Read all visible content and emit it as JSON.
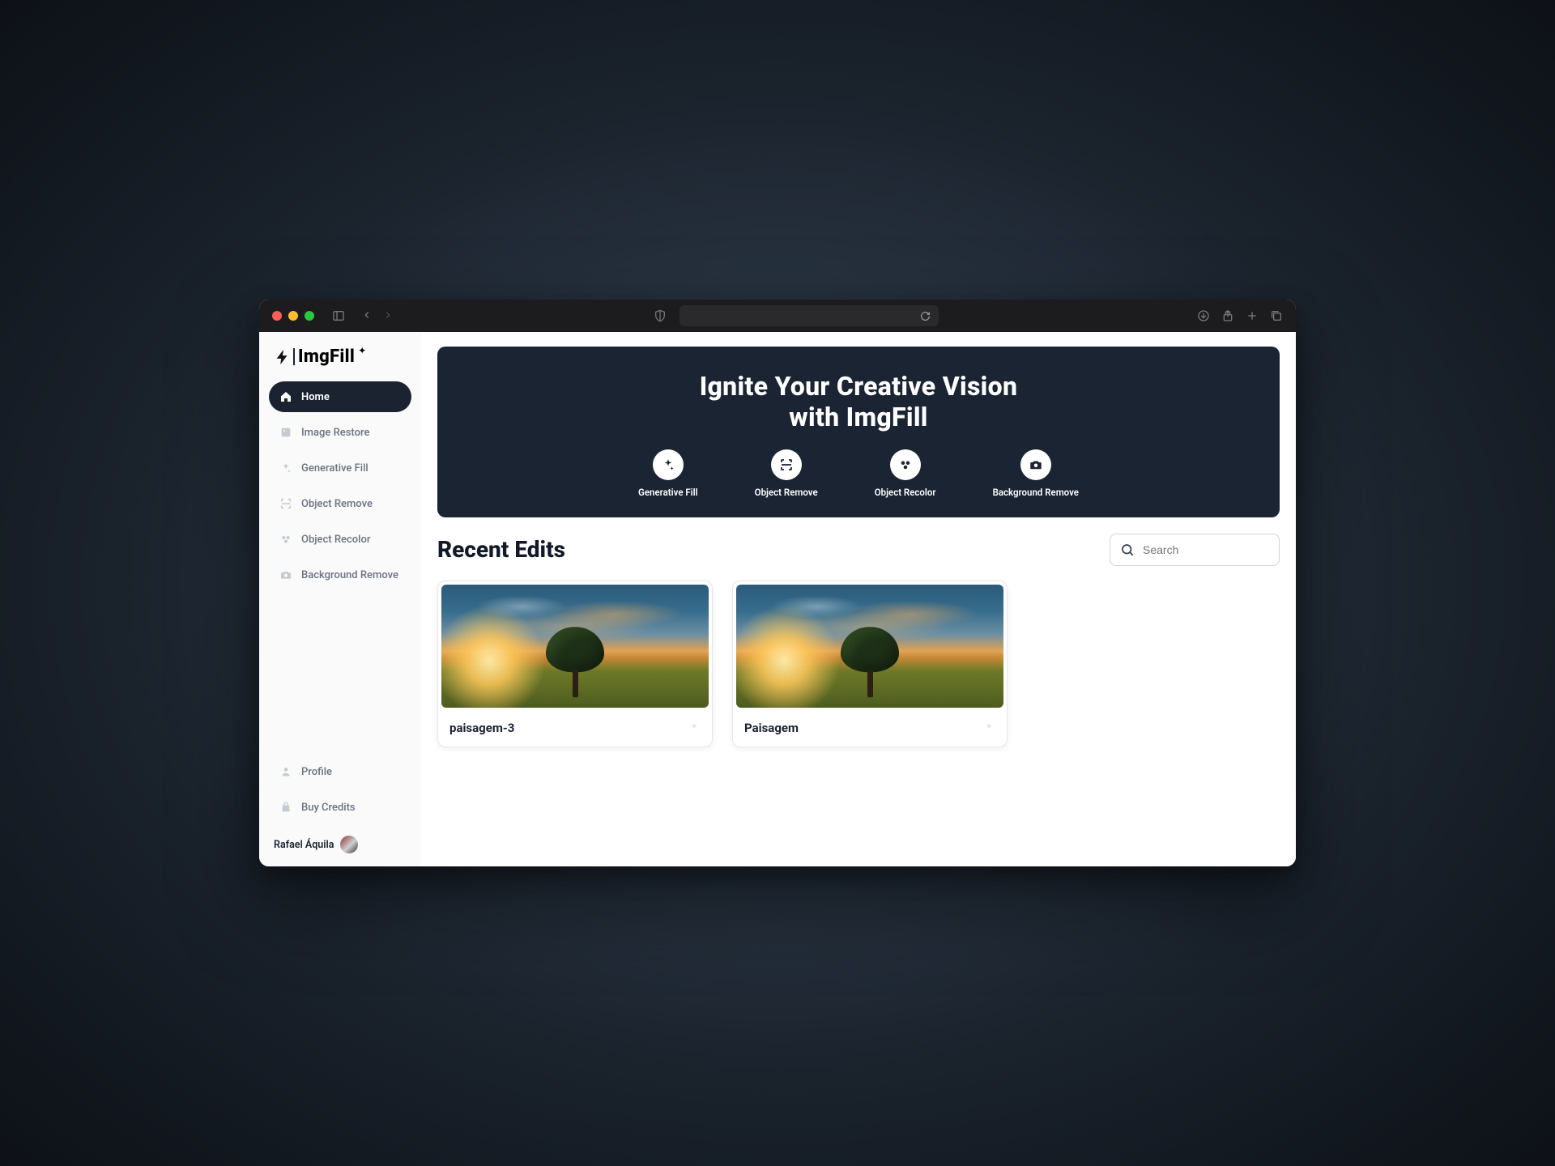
{
  "brand": {
    "name": "ImgFill"
  },
  "sidebar": {
    "items": [
      {
        "label": "Home",
        "icon": "home-icon",
        "active": true
      },
      {
        "label": "Image Restore",
        "icon": "restore-icon",
        "active": false
      },
      {
        "label": "Generative Fill",
        "icon": "sparkle-icon",
        "active": false
      },
      {
        "label": "Object Remove",
        "icon": "scan-icon",
        "active": false
      },
      {
        "label": "Object Recolor",
        "icon": "recolor-icon",
        "active": false
      },
      {
        "label": "Background Remove",
        "icon": "camera-icon",
        "active": false
      }
    ],
    "bottom": [
      {
        "label": "Profile",
        "icon": "person-icon"
      },
      {
        "label": "Buy Credits",
        "icon": "bag-icon"
      }
    ],
    "user": {
      "name": "Rafael Áquila"
    }
  },
  "hero": {
    "title": "Ignite Your Creative Vision with ImgFill",
    "actions": [
      {
        "label": "Generative Fill",
        "icon": "sparkle-icon"
      },
      {
        "label": "Object Remove",
        "icon": "scan-icon"
      },
      {
        "label": "Object Recolor",
        "icon": "recolor-icon"
      },
      {
        "label": "Background Remove",
        "icon": "camera-icon"
      }
    ]
  },
  "section": {
    "title": "Recent Edits"
  },
  "search": {
    "placeholder": "Search"
  },
  "cards": [
    {
      "title": "paisagem-3"
    },
    {
      "title": "Paisagem"
    }
  ]
}
